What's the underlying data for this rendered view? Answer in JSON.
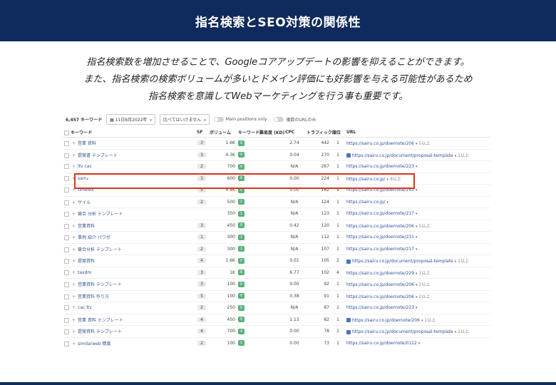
{
  "header": {
    "title": "指名検索とSEO対策の関係性"
  },
  "description": [
    "指名検索数を増加させることで、Googleコアアップデートの影響を抑えることができます。",
    "また、指名検索の検索ボリュームが多いとドメイン評価にも好影響を与える可能性があるため",
    "指名検索を意識してWebマーケティングを行う事も重要です。"
  ],
  "filters": {
    "keyword_count": "6,457 キーワード",
    "date": "11日8月2022年",
    "compare": "比べてはいけません",
    "toggle_main": "Main positions only",
    "toggle_dup": "複数のURLのみ"
  },
  "table": {
    "headers": [
      "キーワード",
      "SF",
      "ボリューム",
      "キーワード難易度 (KD)",
      "CPC",
      "トラフィック",
      "順位",
      "URL"
    ],
    "rows": [
      {
        "kw": "営業 資料",
        "sf": "3",
        "vol": "1.6K",
        "kd": "0",
        "cpc": "2.74",
        "traffic": "442",
        "pos": "1",
        "icon": false,
        "url": "https://sairu.co.jp/doernote/206",
        "extra": "5以上"
      },
      {
        "kw": "提案書 テンプレート",
        "sf": "3",
        "vol": "4.3K",
        "kd": "0",
        "cpc": "0.04",
        "traffic": "270",
        "pos": "1",
        "icon": true,
        "url": "https://sairu.co.jp/document/proposal-template",
        "extra": "1以上"
      },
      {
        "kw": "ltv cac",
        "sf": "2",
        "vol": "700",
        "kd": "0",
        "cpc": "N/A",
        "traffic": "267",
        "pos": "1",
        "icon": false,
        "url": "https://sairu.co.jp/doernote/223",
        "extra": ""
      },
      {
        "kw": "sairu",
        "sf": "3",
        "vol": "600",
        "kd": "6",
        "cpc": "0.00",
        "traffic": "224",
        "pos": "1",
        "icon": false,
        "url": "https://sairu.co.jp/",
        "extra": "4以上"
      },
      {
        "kw": "timelex",
        "sf": "5",
        "vol": "4.4K",
        "kd": "0",
        "cpc": "0.00",
        "traffic": "162",
        "pos": "9",
        "icon": false,
        "url": "https://sairu.co.jp/doernote/243",
        "extra": ""
      },
      {
        "kw": "サイル",
        "sf": "2",
        "vol": "500",
        "kd": "1",
        "cpc": "N/A",
        "traffic": "124",
        "pos": "1",
        "icon": false,
        "url": "https://sairu.co.jp/",
        "extra": ""
      },
      {
        "kw": "競合 分析 テンプレート",
        "sf": "",
        "vol": "350",
        "kd": "1",
        "cpc": "N/A",
        "traffic": "123",
        "pos": "1",
        "icon": false,
        "url": "https://sairu.co.jp/doernote/217",
        "extra": ""
      },
      {
        "kw": "営業資料",
        "sf": "3",
        "vol": "450",
        "kd": "0",
        "cpc": "0.42",
        "traffic": "120",
        "pos": "1",
        "icon": false,
        "url": "https://sairu.co.jp/doernote/206",
        "extra": "5以上"
      },
      {
        "kw": "事例 紹介 パワポ",
        "sf": "1",
        "vol": "300",
        "kd": "2",
        "cpc": "N/A",
        "traffic": "112",
        "pos": "1",
        "icon": false,
        "url": "https://sairu.co.jp/doernote/231",
        "extra": ""
      },
      {
        "kw": "競合分析 テンプレート",
        "sf": "2",
        "vol": "300",
        "kd": "1",
        "cpc": "N/A",
        "traffic": "107",
        "pos": "1",
        "icon": false,
        "url": "https://sairu.co.jp/doernote/217",
        "extra": ""
      },
      {
        "kw": "提案資料",
        "sf": "4",
        "vol": "1.6K",
        "kd": "0",
        "cpc": "0.01",
        "traffic": "105",
        "pos": "2",
        "icon": true,
        "url": "https://sairu.co.jp/document/proposal-template",
        "extra": "1以上"
      },
      {
        "kw": "taxdm",
        "sf": "3",
        "vol": "1K",
        "kd": "6",
        "cpc": "6.77",
        "traffic": "102",
        "pos": "4",
        "icon": false,
        "url": "https://sairu.co.jp/doernote/229",
        "extra": "1以上"
      },
      {
        "kw": "営業資料 テンプレート",
        "sf": "3",
        "vol": "100",
        "kd": "0",
        "cpc": "0.00",
        "traffic": "92",
        "pos": "1",
        "icon": false,
        "url": "https://sairu.co.jp/doernote/206",
        "extra": "2以上"
      },
      {
        "kw": "営業資料 作り方",
        "sf": "5",
        "vol": "100",
        "kd": "0",
        "cpc": "0.38",
        "traffic": "91",
        "pos": "1",
        "icon": false,
        "url": "https://sairu.co.jp/doernote/206",
        "extra": "2以上"
      },
      {
        "kw": "cac ltv",
        "sf": "2",
        "vol": "250",
        "kd": "0",
        "cpc": "N/A",
        "traffic": "87",
        "pos": "1",
        "icon": false,
        "url": "https://sairu.co.jp/doernote/223",
        "extra": ""
      },
      {
        "kw": "営業 資料 テンプレート",
        "sf": "4",
        "vol": "450",
        "kd": "0",
        "cpc": "1.13",
        "traffic": "82",
        "pos": "1",
        "icon": true,
        "url": "https://sairu.co.jp/doernote/206",
        "extra": "1以上"
      },
      {
        "kw": "提案資料 テンプレート",
        "sf": "4",
        "vol": "700",
        "kd": "4",
        "cpc": "0.00",
        "traffic": "78",
        "pos": "1",
        "icon": true,
        "url": "https://sairu.co.jp/document/proposal-template",
        "extra": "1以上"
      },
      {
        "kw": "similarweb 精度",
        "sf": "2",
        "vol": "100",
        "kd": "1",
        "cpc": "0.00",
        "traffic": "73",
        "pos": "1",
        "icon": false,
        "url": "https://sairu.co.jp/doernote/0122",
        "extra": ""
      }
    ]
  },
  "colors": {
    "header_bg": "#0f2a5c",
    "highlight": "#d9361b",
    "kd_green": "#59b27a"
  }
}
